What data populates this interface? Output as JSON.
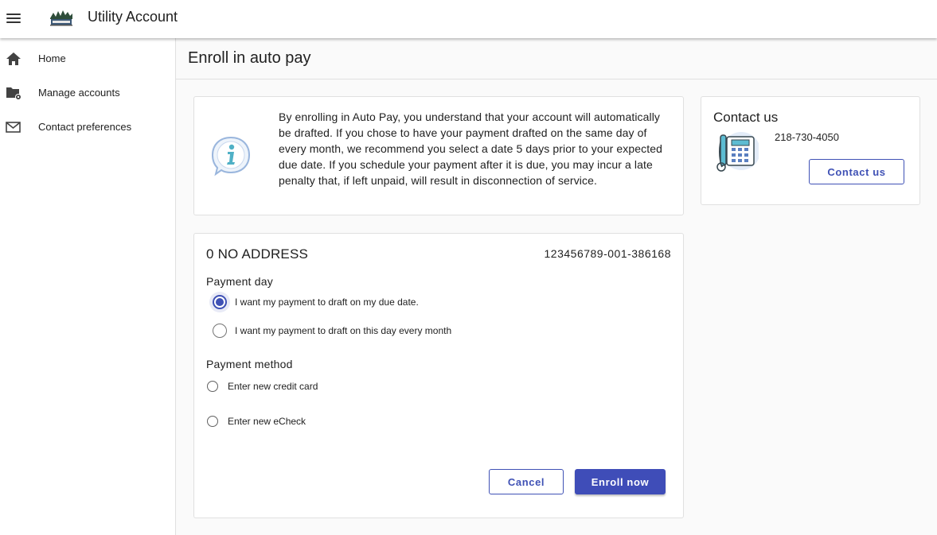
{
  "app": {
    "title": "Utility Account"
  },
  "sidebar": {
    "items": [
      {
        "label": "Home",
        "icon": "home-icon"
      },
      {
        "label": "Manage accounts",
        "icon": "folder-settings-icon"
      },
      {
        "label": "Contact preferences",
        "icon": "mail-icon"
      }
    ]
  },
  "page": {
    "title": "Enroll in auto pay"
  },
  "info": {
    "icon": "info-icon",
    "text": "By enrolling in Auto Pay, you understand that your account will automatically be drafted. If you chose to have your payment drafted on the same day of every month, we recommend you select a date 5 days prior to your expected due date. If you schedule your payment after it is due, you may incur a late penalty that, if left unpaid, will result in disconnection of service."
  },
  "contact": {
    "title": "Contact us",
    "phone": "218-730-4050",
    "button_label": "Contact us",
    "icon": "telephone-icon"
  },
  "account": {
    "address": "0 NO ADDRESS",
    "number": "123456789-001-386168"
  },
  "payment_day": {
    "label": "Payment day",
    "options": [
      {
        "label": "I want my payment to draft on my due date.",
        "selected": true
      },
      {
        "label": "I want my payment to draft on this day every month",
        "selected": false
      }
    ]
  },
  "payment_method": {
    "label": "Payment method",
    "options": [
      {
        "label": "Enter new credit card",
        "selected": false
      },
      {
        "label": "Enter new eCheck",
        "selected": false
      }
    ]
  },
  "actions": {
    "cancel_label": "Cancel",
    "enroll_label": "Enroll now"
  },
  "colors": {
    "primary": "#3f51b5",
    "info_icon": "#4fb0c6",
    "border": "#e0e0e0"
  }
}
